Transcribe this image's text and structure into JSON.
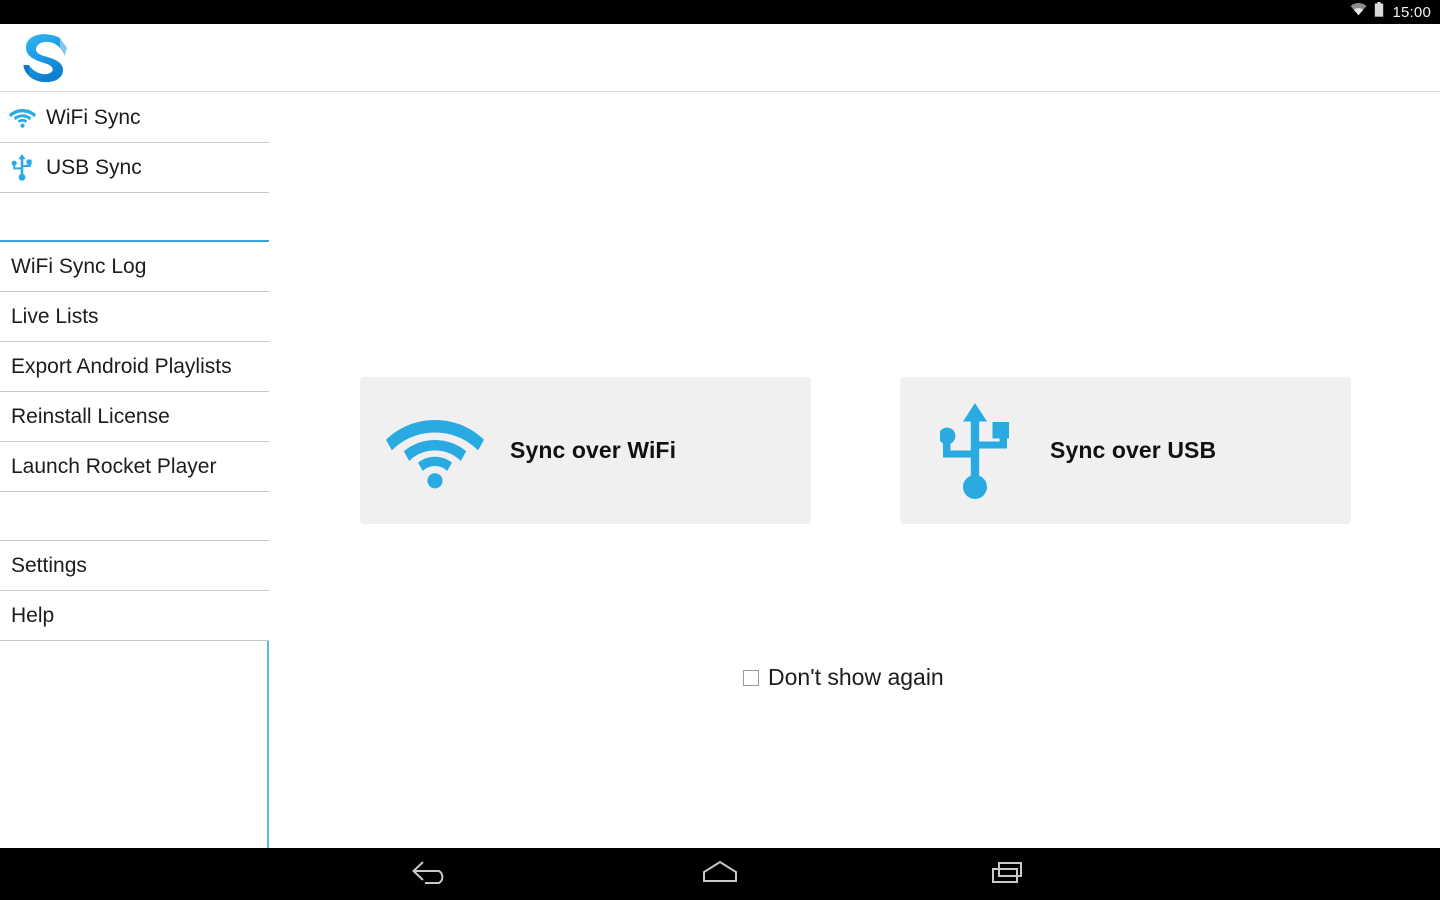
{
  "status_bar": {
    "time": "15:00",
    "icons": [
      "wifi-icon",
      "battery-icon"
    ]
  },
  "header": {
    "logo_name": "sync-app-logo",
    "logo_color": "#1fa0e8"
  },
  "colors": {
    "accent_blue": "#29abe2",
    "sidebar_border": "#5bb9e8",
    "button_bg": "#f0f0f0",
    "separator": "#c9c9c9",
    "text": "#1c1c1c"
  },
  "sidebar": {
    "groups": [
      {
        "items": [
          {
            "label": "WiFi Sync",
            "icon": "wifi-icon",
            "has_icon": true
          },
          {
            "label": "USB Sync",
            "icon": "usb-icon",
            "has_icon": true
          }
        ]
      },
      {
        "items": [
          {
            "label": "WiFi Sync Log",
            "has_icon": false
          },
          {
            "label": "Live Lists",
            "has_icon": false
          },
          {
            "label": "Export Android Playlists",
            "has_icon": false
          },
          {
            "label": "Reinstall License",
            "has_icon": false
          },
          {
            "label": "Launch Rocket Player",
            "has_icon": false
          }
        ]
      },
      {
        "items": [
          {
            "label": "Settings",
            "has_icon": false
          },
          {
            "label": "Help",
            "has_icon": false
          }
        ]
      }
    ]
  },
  "main": {
    "buttons": [
      {
        "label": "Sync over WiFi",
        "icon": "wifi-icon"
      },
      {
        "label": "Sync over USB",
        "icon": "usb-icon"
      }
    ],
    "checkbox": {
      "label": "Don't show again",
      "checked": false
    }
  },
  "nav_bar": {
    "buttons": [
      {
        "name": "back-button",
        "icon": "back-arrow-icon"
      },
      {
        "name": "home-button",
        "icon": "home-icon"
      },
      {
        "name": "recents-button",
        "icon": "recents-icon"
      }
    ]
  }
}
